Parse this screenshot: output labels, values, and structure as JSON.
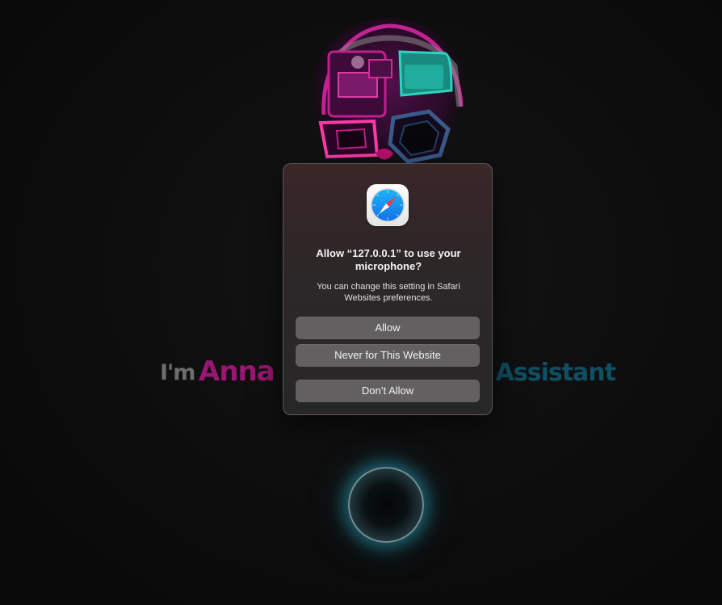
{
  "background": {
    "headline": {
      "lead": "I'm",
      "name": "Anna",
      "role": "Assistant"
    },
    "colors": {
      "name": "#9b1674",
      "role": "#0e4f64",
      "orb_glow": "#2896aa"
    },
    "icons": {
      "avatar": "neon-robot-avatar-icon",
      "mic": "microphone-orb-icon"
    }
  },
  "dialog": {
    "app_icon": "safari-compass-icon",
    "title": "Allow “127.0.0.1” to use your microphone?",
    "message": "You can change this setting in Safari Websites preferences.",
    "buttons": {
      "allow": "Allow",
      "never": "Never for This Website",
      "deny": "Don’t Allow"
    }
  }
}
